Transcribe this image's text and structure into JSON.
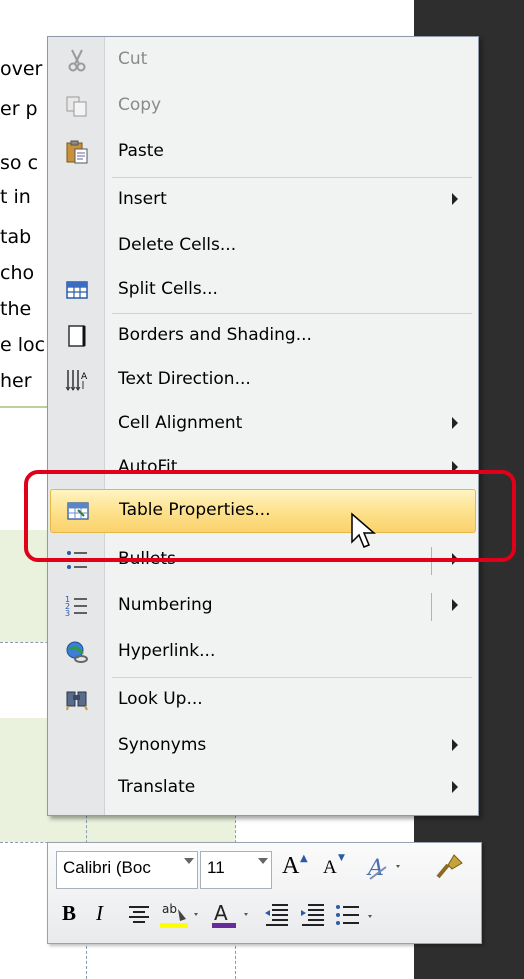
{
  "document": {
    "lines": [
      "over",
      "er p",
      "so c",
      "t in",
      "tab",
      "cho",
      "the",
      "e loc",
      "her"
    ]
  },
  "menu": {
    "items": [
      {
        "label": "Cut",
        "icon": "scissors-icon",
        "disabled": true
      },
      {
        "label": "Copy",
        "icon": "copy-icon",
        "disabled": true
      },
      {
        "label": "Paste",
        "icon": "paste-icon",
        "disabled": false
      },
      {
        "label": "Insert",
        "icon": "",
        "submenu": true
      },
      {
        "label": "Delete Cells...",
        "icon": ""
      },
      {
        "label": "Split Cells...",
        "icon": "split-cells-icon"
      },
      {
        "label": "Borders and Shading...",
        "icon": "borders-icon"
      },
      {
        "label": "Text Direction...",
        "icon": "text-direction-icon"
      },
      {
        "label": "Cell Alignment",
        "icon": "",
        "submenu": true
      },
      {
        "label": "AutoFit",
        "icon": "",
        "submenu": true
      },
      {
        "label": "Table Properties...",
        "icon": "table-properties-icon",
        "highlighted": true
      },
      {
        "label": "Bullets",
        "icon": "bullets-icon",
        "submenu": true
      },
      {
        "label": "Numbering",
        "icon": "numbering-icon",
        "submenu": true
      },
      {
        "label": "Hyperlink...",
        "icon": "hyperlink-icon"
      },
      {
        "label": "Look Up...",
        "icon": "lookup-icon"
      },
      {
        "label": "Synonyms",
        "icon": "",
        "submenu": true
      },
      {
        "label": "Translate",
        "icon": "",
        "submenu": true
      }
    ]
  },
  "toolbar": {
    "font_name": "Calibri (Boc",
    "font_size": "11",
    "grow_font": "A",
    "shrink_font": "A",
    "bold": "B",
    "italic": "I",
    "font_color_letter": "A",
    "highlight_label": "ab"
  },
  "colors": {
    "highlight": "#fde08a",
    "annotation": "#e0001a"
  }
}
